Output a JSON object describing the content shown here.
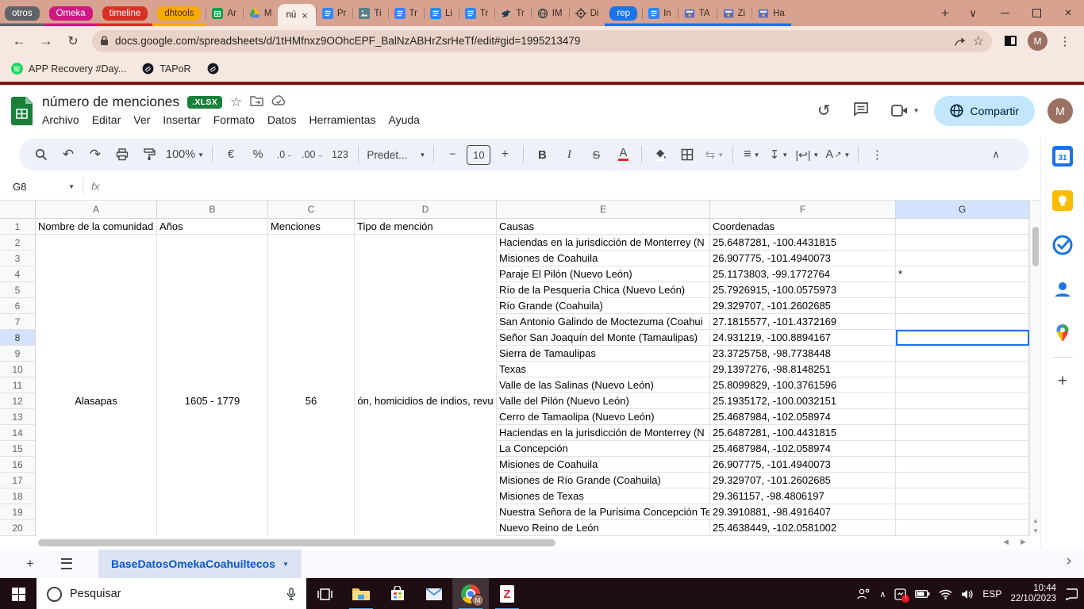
{
  "browser": {
    "tabs": [
      {
        "kind": "chip",
        "label": "otros",
        "color": "#5f6368"
      },
      {
        "kind": "chip",
        "label": "Omeka",
        "color": "#d01884"
      },
      {
        "kind": "chip",
        "label": "timeline",
        "color": "#d93025"
      },
      {
        "kind": "chip",
        "label": "dhtools",
        "color": "#f9ab00",
        "dark_text": true
      },
      {
        "kind": "tab",
        "icon": "sheets-icon",
        "label": "Ar"
      },
      {
        "kind": "tab",
        "icon": "drive-icon",
        "label": "M"
      },
      {
        "kind": "tab",
        "icon": "none",
        "label": "nú",
        "active": true
      },
      {
        "kind": "tab",
        "icon": "docs-icon",
        "label": "Pr"
      },
      {
        "kind": "tab",
        "icon": "image-icon",
        "label": "Ti"
      },
      {
        "kind": "tab",
        "icon": "docs-icon",
        "label": "Tr"
      },
      {
        "kind": "tab",
        "icon": "docs-icon",
        "label": "Li"
      },
      {
        "kind": "tab",
        "icon": "docs-icon",
        "label": "Tr"
      },
      {
        "kind": "tab",
        "icon": "bird-icon",
        "label": "Tr"
      },
      {
        "kind": "tab",
        "icon": "globe-icon",
        "label": "IM"
      },
      {
        "kind": "tab",
        "icon": "compass-icon",
        "label": "Di"
      },
      {
        "kind": "chip",
        "label": "rep",
        "color": "#1a73e8",
        "grouped": true
      },
      {
        "kind": "tab",
        "icon": "docs-icon",
        "label": "In",
        "grouped": true
      },
      {
        "kind": "tab",
        "icon": "box-icon",
        "label": "TA",
        "grouped": true
      },
      {
        "kind": "tab",
        "icon": "box-icon",
        "label": "Zi",
        "grouped": true
      },
      {
        "kind": "tab",
        "icon": "box-icon",
        "label": "Ha",
        "grouped": true
      }
    ],
    "url": "docs.google.com/spreadsheets/d/1tHMfnxz9OOhcEPF_BalNzABHrZsrHeTf/edit#gid=1995213479",
    "bookmarks": [
      {
        "label": "APP Recovery #Day...",
        "icon": "spotify-icon"
      },
      {
        "label": "TAPoR",
        "icon": "dark-globe-icon"
      },
      {
        "label": "",
        "icon": "dark-globe-icon"
      }
    ],
    "avatar": "M"
  },
  "sheets": {
    "title": "número de menciones",
    "badge": ".XLSX",
    "menus": [
      "Archivo",
      "Editar",
      "Ver",
      "Insertar",
      "Formato",
      "Datos",
      "Herramientas",
      "Ayuda"
    ],
    "share_label": "Compartir",
    "toolbar": {
      "zoom": "100%",
      "euro": "€",
      "percent": "%",
      "dec0": ".0",
      "dec00": ".00",
      "num123": "123",
      "format": "Predet...",
      "minus": "−",
      "font_size": "10",
      "plus": "+",
      "bold": "B",
      "italic": "I",
      "strike": "S",
      "text_color": "A",
      "rotate": "A"
    },
    "name_box": "G8",
    "fx_label": "fx",
    "sheet_tab": "BaseDatosOmekaCoahuiltecos",
    "accent": "#1a73e8"
  },
  "grid": {
    "col_letters": [
      "A",
      "B",
      "C",
      "D",
      "E",
      "F",
      "G"
    ],
    "headers": {
      "a": "Nombre de la comunidad",
      "b": "Años",
      "c": "Menciones",
      "d": "Tipo de mención",
      "e": "Causas",
      "f": "Coordenadas"
    },
    "merged": {
      "a": "Alasapas",
      "b": "1605 - 1779",
      "c": "56",
      "d": "ón, homicidios de indios, revu"
    },
    "rows": [
      {
        "n": 2,
        "e": "Haciendas en la jurisdicción de Monterrey (N",
        "f": "25.6487281, -100.4431815",
        "g": ""
      },
      {
        "n": 3,
        "e": "Misiones de Coahuila",
        "f": "26.907775, -101.4940073",
        "g": ""
      },
      {
        "n": 4,
        "e": "Paraje El Pilón (Nuevo León)",
        "f": "25.1173803, -99.1772764",
        "g": "*"
      },
      {
        "n": 5,
        "e": "Río de la Pesquería Chica (Nuevo León)",
        "f": "25.7926915, -100.0575973",
        "g": ""
      },
      {
        "n": 6,
        "e": "Río Grande (Coahuila)",
        "f": "29.329707, -101.2602685",
        "g": ""
      },
      {
        "n": 7,
        "e": "San Antonio Galindo de Moctezuma (Coahui",
        "f": "27.1815577, -101.4372169",
        "g": ""
      },
      {
        "n": 8,
        "e": "Señor San Joaquín del Monte (Tamaulipas)",
        "f": "24.931219, -100.8894167",
        "g": ""
      },
      {
        "n": 9,
        "e": "Sierra de Tamaulipas",
        "f": "23.3725758, -98.7738448",
        "g": ""
      },
      {
        "n": 10,
        "e": "Texas",
        "f": "29.1397276, -98.8148251",
        "g": ""
      },
      {
        "n": 11,
        "e": "Valle de las Salinas (Nuevo León)",
        "f": "25.8099829, -100.3761596",
        "g": ""
      },
      {
        "n": 12,
        "e": "Valle del Pilón (Nuevo León)",
        "f": "25.1935172, -100.0032151",
        "g": ""
      },
      {
        "n": 13,
        "e": "Cerro de Tamaolipa (Nuevo León)",
        "f": "25.4687984, -102.058974",
        "g": ""
      },
      {
        "n": 14,
        "e": "Haciendas en la jurisdicción de Monterrey (N",
        "f": "25.6487281, -100.4431815",
        "g": ""
      },
      {
        "n": 15,
        "e": "La Concepción",
        "f": "25.4687984, -102.058974",
        "g": ""
      },
      {
        "n": 16,
        "e": "Misiones de Coahuila",
        "f": "26.907775, -101.4940073",
        "g": ""
      },
      {
        "n": 17,
        "e": "Misiones de Río Grande (Coahuila)",
        "f": "29.329707, -101.2602685",
        "g": ""
      },
      {
        "n": 18,
        "e": "Misiones de Texas",
        "f": "29.361157, -98.4806197",
        "g": ""
      },
      {
        "n": 19,
        "e": "Nuestra Señora de la Purísima Concepción Te",
        "f": "29.3910881, -98.4916407",
        "g": ""
      },
      {
        "n": 20,
        "e": "Nuevo Reino de León",
        "f": "25.4638449, -102.0581002",
        "g": ""
      }
    ],
    "selected_cell": "G8"
  },
  "taskbar": {
    "search_placeholder": "Pesquisar",
    "lang": "ESP",
    "time": "10:44",
    "date": "22/10/2023"
  }
}
